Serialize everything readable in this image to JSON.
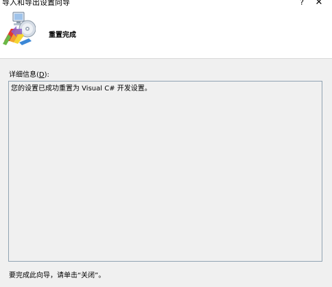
{
  "window": {
    "title": "导入和导出设置向导",
    "help_glyph": "?",
    "close_glyph": "✕"
  },
  "header": {
    "title": "重置完成",
    "icon": "import-export-wizard-icon"
  },
  "details": {
    "label_prefix": "详细信息(",
    "label_accesskey": "D",
    "label_suffix": "):",
    "text": "您的设置已成功重置为 Visual C# 开发设置。"
  },
  "footer": {
    "instruction": "要完成此向导，请单击“关闭”。"
  },
  "colors": {
    "background": "#f0f0f0",
    "header_background": "#ffffff",
    "textbox_border": "#8fa2b2"
  }
}
